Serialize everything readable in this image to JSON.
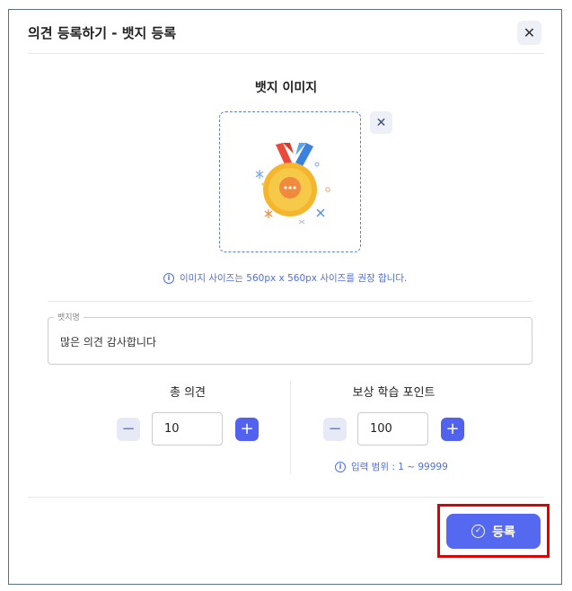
{
  "dialog": {
    "title": "의견 등록하기 - 뱃지 등록",
    "close_glyph": "✕"
  },
  "badge_image": {
    "section_title": "뱃지 이미지",
    "remove_glyph": "✕",
    "info_text": "이미지 사이즈는 560px x 560px 사이즈를 권장 합니다.",
    "medal_ribbon_colors": [
      "#e84a3c",
      "#3b82e0"
    ],
    "medal_color": "#f5b62e"
  },
  "badge_name": {
    "label": "뱃지명",
    "value": "많은 의견 감사합니다"
  },
  "total_opinions": {
    "label": "총 의견",
    "value": "10",
    "minus": "−",
    "plus": "+"
  },
  "reward_points": {
    "label": "보상 학습 포인트",
    "value": "100",
    "minus": "−",
    "plus": "+",
    "range_text": "입력 범위 : 1 ~ 99999"
  },
  "submit": {
    "label": "등록",
    "icon_glyph": "✓"
  },
  "colors": {
    "accent": "#5468f0",
    "info": "#4d6ee8",
    "highlight": "#e00000"
  }
}
